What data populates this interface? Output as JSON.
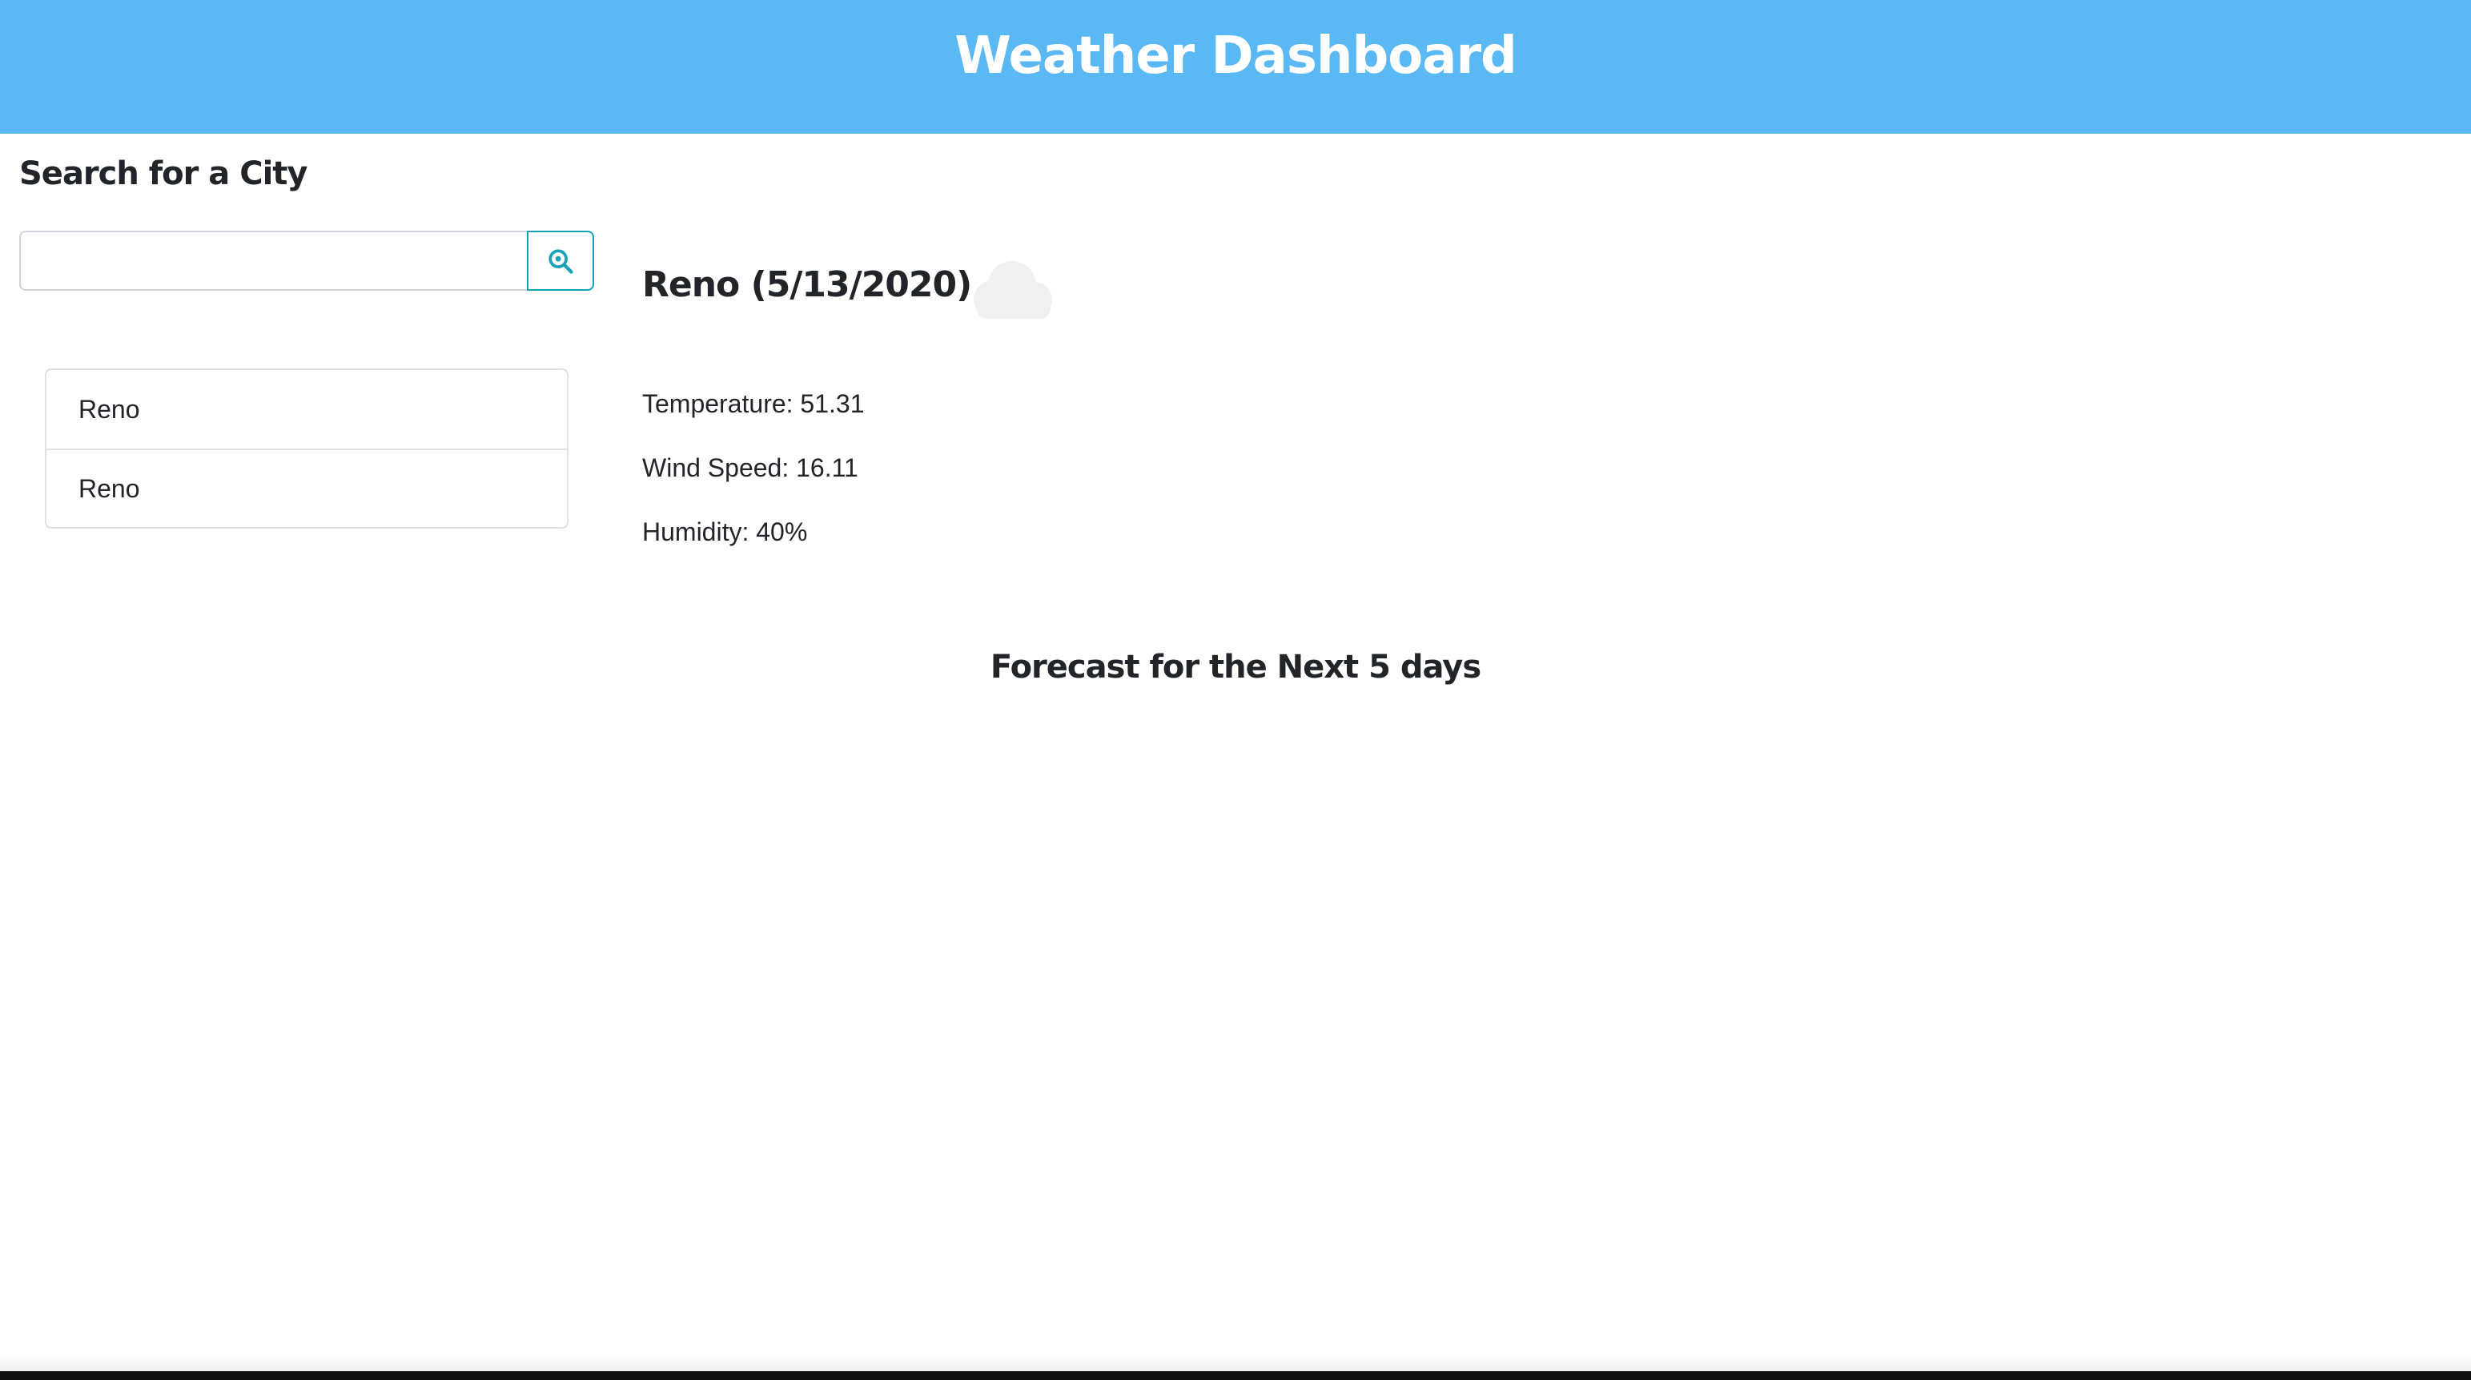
{
  "header": {
    "title": "Weather Dashboard",
    "background_color": "#5ab8f4"
  },
  "search": {
    "heading": "Search for a City",
    "input_value": "",
    "input_placeholder": "",
    "button_icon": "search-icon",
    "button_color": "#17a2b8"
  },
  "history": {
    "items": [
      {
        "label": "Reno"
      },
      {
        "label": "Reno"
      }
    ]
  },
  "current": {
    "title": "Reno (5/13/2020)",
    "icon": "cloud-icon",
    "temperature": "Temperature: 51.31",
    "wind_speed": "Wind Speed: 16.11",
    "humidity": "Humidity: 40%"
  },
  "forecast": {
    "heading": "Forecast for the Next 5 days"
  }
}
